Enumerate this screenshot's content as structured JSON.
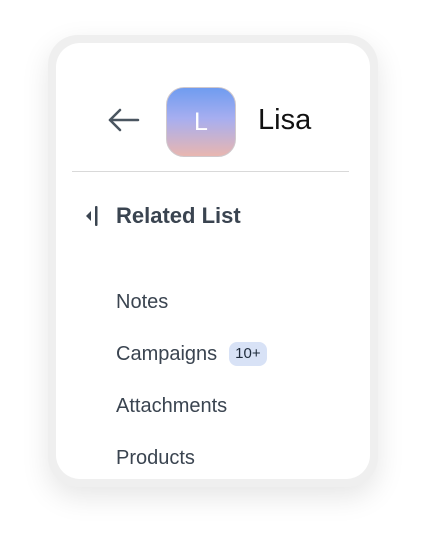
{
  "header": {
    "avatar_letter": "L",
    "name": "Lisa"
  },
  "icons": {
    "back": "arrow-left-icon",
    "collapse": "collapse-left-icon"
  },
  "colors": {
    "text": "#3a4450",
    "badge_bg": "#d8e2f6",
    "avatar_top": "#6f9cf0",
    "avatar_bottom": "#e8b6b0"
  },
  "related_list": {
    "title": "Related List",
    "items": [
      {
        "label": "Notes",
        "badge": ""
      },
      {
        "label": "Campaigns",
        "badge": "10+"
      },
      {
        "label": "Attachments",
        "badge": ""
      },
      {
        "label": "Products",
        "badge": ""
      }
    ]
  }
}
